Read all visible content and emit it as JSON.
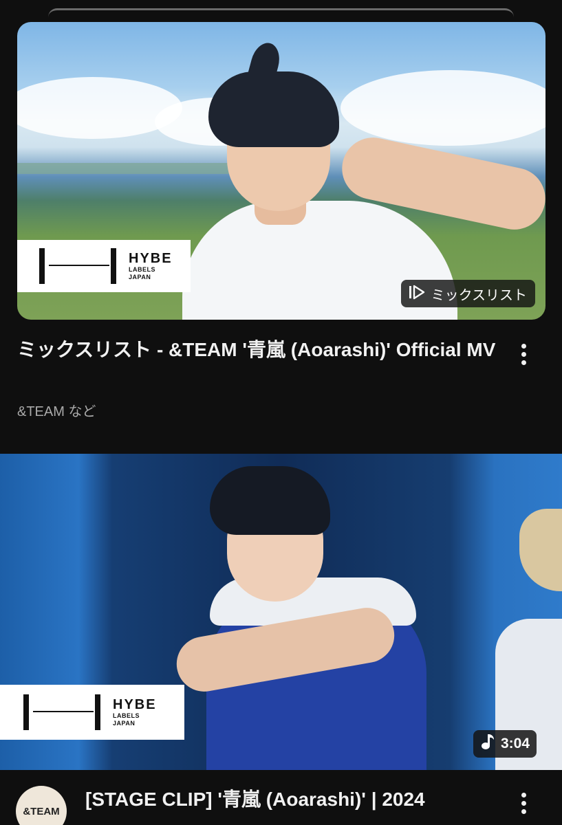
{
  "mix_card": {
    "thumbnail_logo": {
      "name": "HYBE",
      "line1": "LABELS",
      "line2": "JAPAN"
    },
    "badge_label": "ミックスリスト",
    "title": "ミックスリスト - &TEAM '青嵐 (Aoarashi)' Official MV",
    "subtitle": "&TEAM など"
  },
  "video_card": {
    "thumbnail_logo": {
      "name": "HYBE",
      "line1": "LABELS",
      "line2": "JAPAN"
    },
    "duration": "3:04",
    "channel_avatar_text": "&TEAM",
    "title": "[STAGE CLIP] '青嵐 (Aoarashi)' | 2024"
  },
  "icons": [
    "mix-playlist-icon",
    "more-vert-icon",
    "music-note-icon"
  ]
}
